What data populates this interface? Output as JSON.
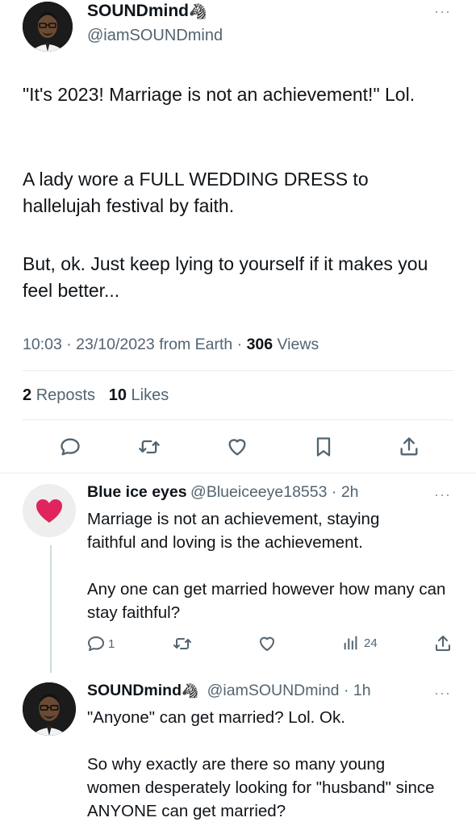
{
  "main_tweet": {
    "author_name": "SOUNDmind",
    "author_emoji": "🦓",
    "author_handle": "@iamSOUNDmind",
    "more": "···",
    "paragraphs": [
      "\"It's 2023! Marriage is not an achievement!\" Lol.",
      "A lady wore a FULL WEDDING DRESS to hallelujah festival by faith.",
      "But, ok. Just keep lying to yourself if it makes you feel better..."
    ],
    "time": "10:03",
    "date": "23/10/2023",
    "source": "from Earth",
    "views_count": "306",
    "views_label": "Views",
    "reposts_count": "2",
    "reposts_label": "Reposts",
    "likes_count": "10",
    "likes_label": "Likes"
  },
  "reply1": {
    "author_name": "Blue ice eyes",
    "author_handle": "@Blueiceeye18553",
    "time": "2h",
    "more": "···",
    "avatar_emoji": "❤️",
    "paragraphs": [
      "Marriage is not an achievement, staying faithful and loving is the achievement.",
      "Any one can get married however how many can stay faithful?"
    ],
    "reply_count": "1",
    "views_count": "24"
  },
  "reply2": {
    "author_name": "SOUNDmind",
    "author_emoji": "🦓",
    "author_handle": "@iamSOUNDmind",
    "time": "1h",
    "more": "···",
    "paragraphs": [
      "\"Anyone\" can get married? Lol. Ok.",
      "So why exactly are there so many young women desperately looking for \"husband\" since ANYONE can get married?"
    ]
  },
  "colors": {
    "text": "#0f1419",
    "secondary": "#536471",
    "divider": "#e6ecf0",
    "heart": "#e0245e"
  }
}
